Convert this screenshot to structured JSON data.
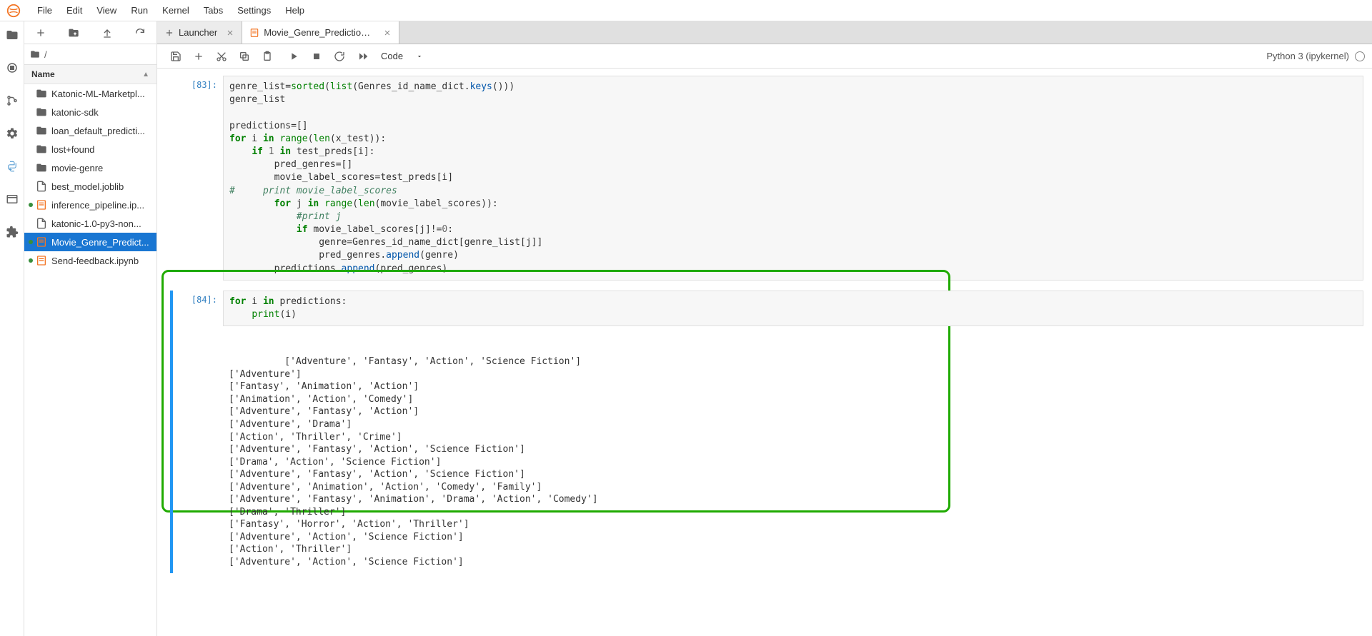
{
  "menu": {
    "items": [
      "File",
      "Edit",
      "View",
      "Run",
      "Kernel",
      "Tabs",
      "Settings",
      "Help"
    ]
  },
  "filebrowser": {
    "breadcrumb_root": "/",
    "header_label": "Name",
    "items": [
      {
        "icon": "folder",
        "label": "Katonic-ML-Marketpl...",
        "running": false
      },
      {
        "icon": "folder",
        "label": "katonic-sdk",
        "running": false
      },
      {
        "icon": "folder",
        "label": "loan_default_predicti...",
        "running": false
      },
      {
        "icon": "folder",
        "label": "lost+found",
        "running": false
      },
      {
        "icon": "folder",
        "label": "movie-genre",
        "running": false
      },
      {
        "icon": "file",
        "label": "best_model.joblib",
        "running": false
      },
      {
        "icon": "notebook",
        "label": "inference_pipeline.ip...",
        "running": true
      },
      {
        "icon": "file",
        "label": "katonic-1.0-py3-non...",
        "running": false
      },
      {
        "icon": "notebook",
        "label": "Movie_Genre_Predict...",
        "running": true,
        "selected": true
      },
      {
        "icon": "notebook",
        "label": "Send-feedback.ipynb",
        "running": true
      }
    ]
  },
  "tabs": [
    {
      "icon": "plus",
      "label": "Launcher",
      "active": false
    },
    {
      "icon": "notebook",
      "label": "Movie_Genre_Prediction.ipyn",
      "active": true
    }
  ],
  "toolbar": {
    "celltype": "Code",
    "kernel_label": "Python 3 (ipykernel)"
  },
  "cells": {
    "cell83_prompt": "[83]:",
    "cell84_prompt": "[84]:"
  },
  "output84_lines": [
    "['Adventure', 'Fantasy', 'Action', 'Science Fiction']",
    "['Adventure']",
    "['Fantasy', 'Animation', 'Action']",
    "['Animation', 'Action', 'Comedy']",
    "['Adventure', 'Fantasy', 'Action']",
    "['Adventure', 'Drama']",
    "['Action', 'Thriller', 'Crime']",
    "['Adventure', 'Fantasy', 'Action', 'Science Fiction']",
    "['Drama', 'Action', 'Science Fiction']",
    "['Adventure', 'Fantasy', 'Action', 'Science Fiction']",
    "['Adventure', 'Animation', 'Action', 'Comedy', 'Family']",
    "['Adventure', 'Fantasy', 'Animation', 'Drama', 'Action', 'Comedy']",
    "['Drama', 'Thriller']",
    "['Fantasy', 'Horror', 'Action', 'Thriller']",
    "['Adventure', 'Action', 'Science Fiction']",
    "['Action', 'Thriller']",
    "['Adventure', 'Action', 'Science Fiction']"
  ]
}
